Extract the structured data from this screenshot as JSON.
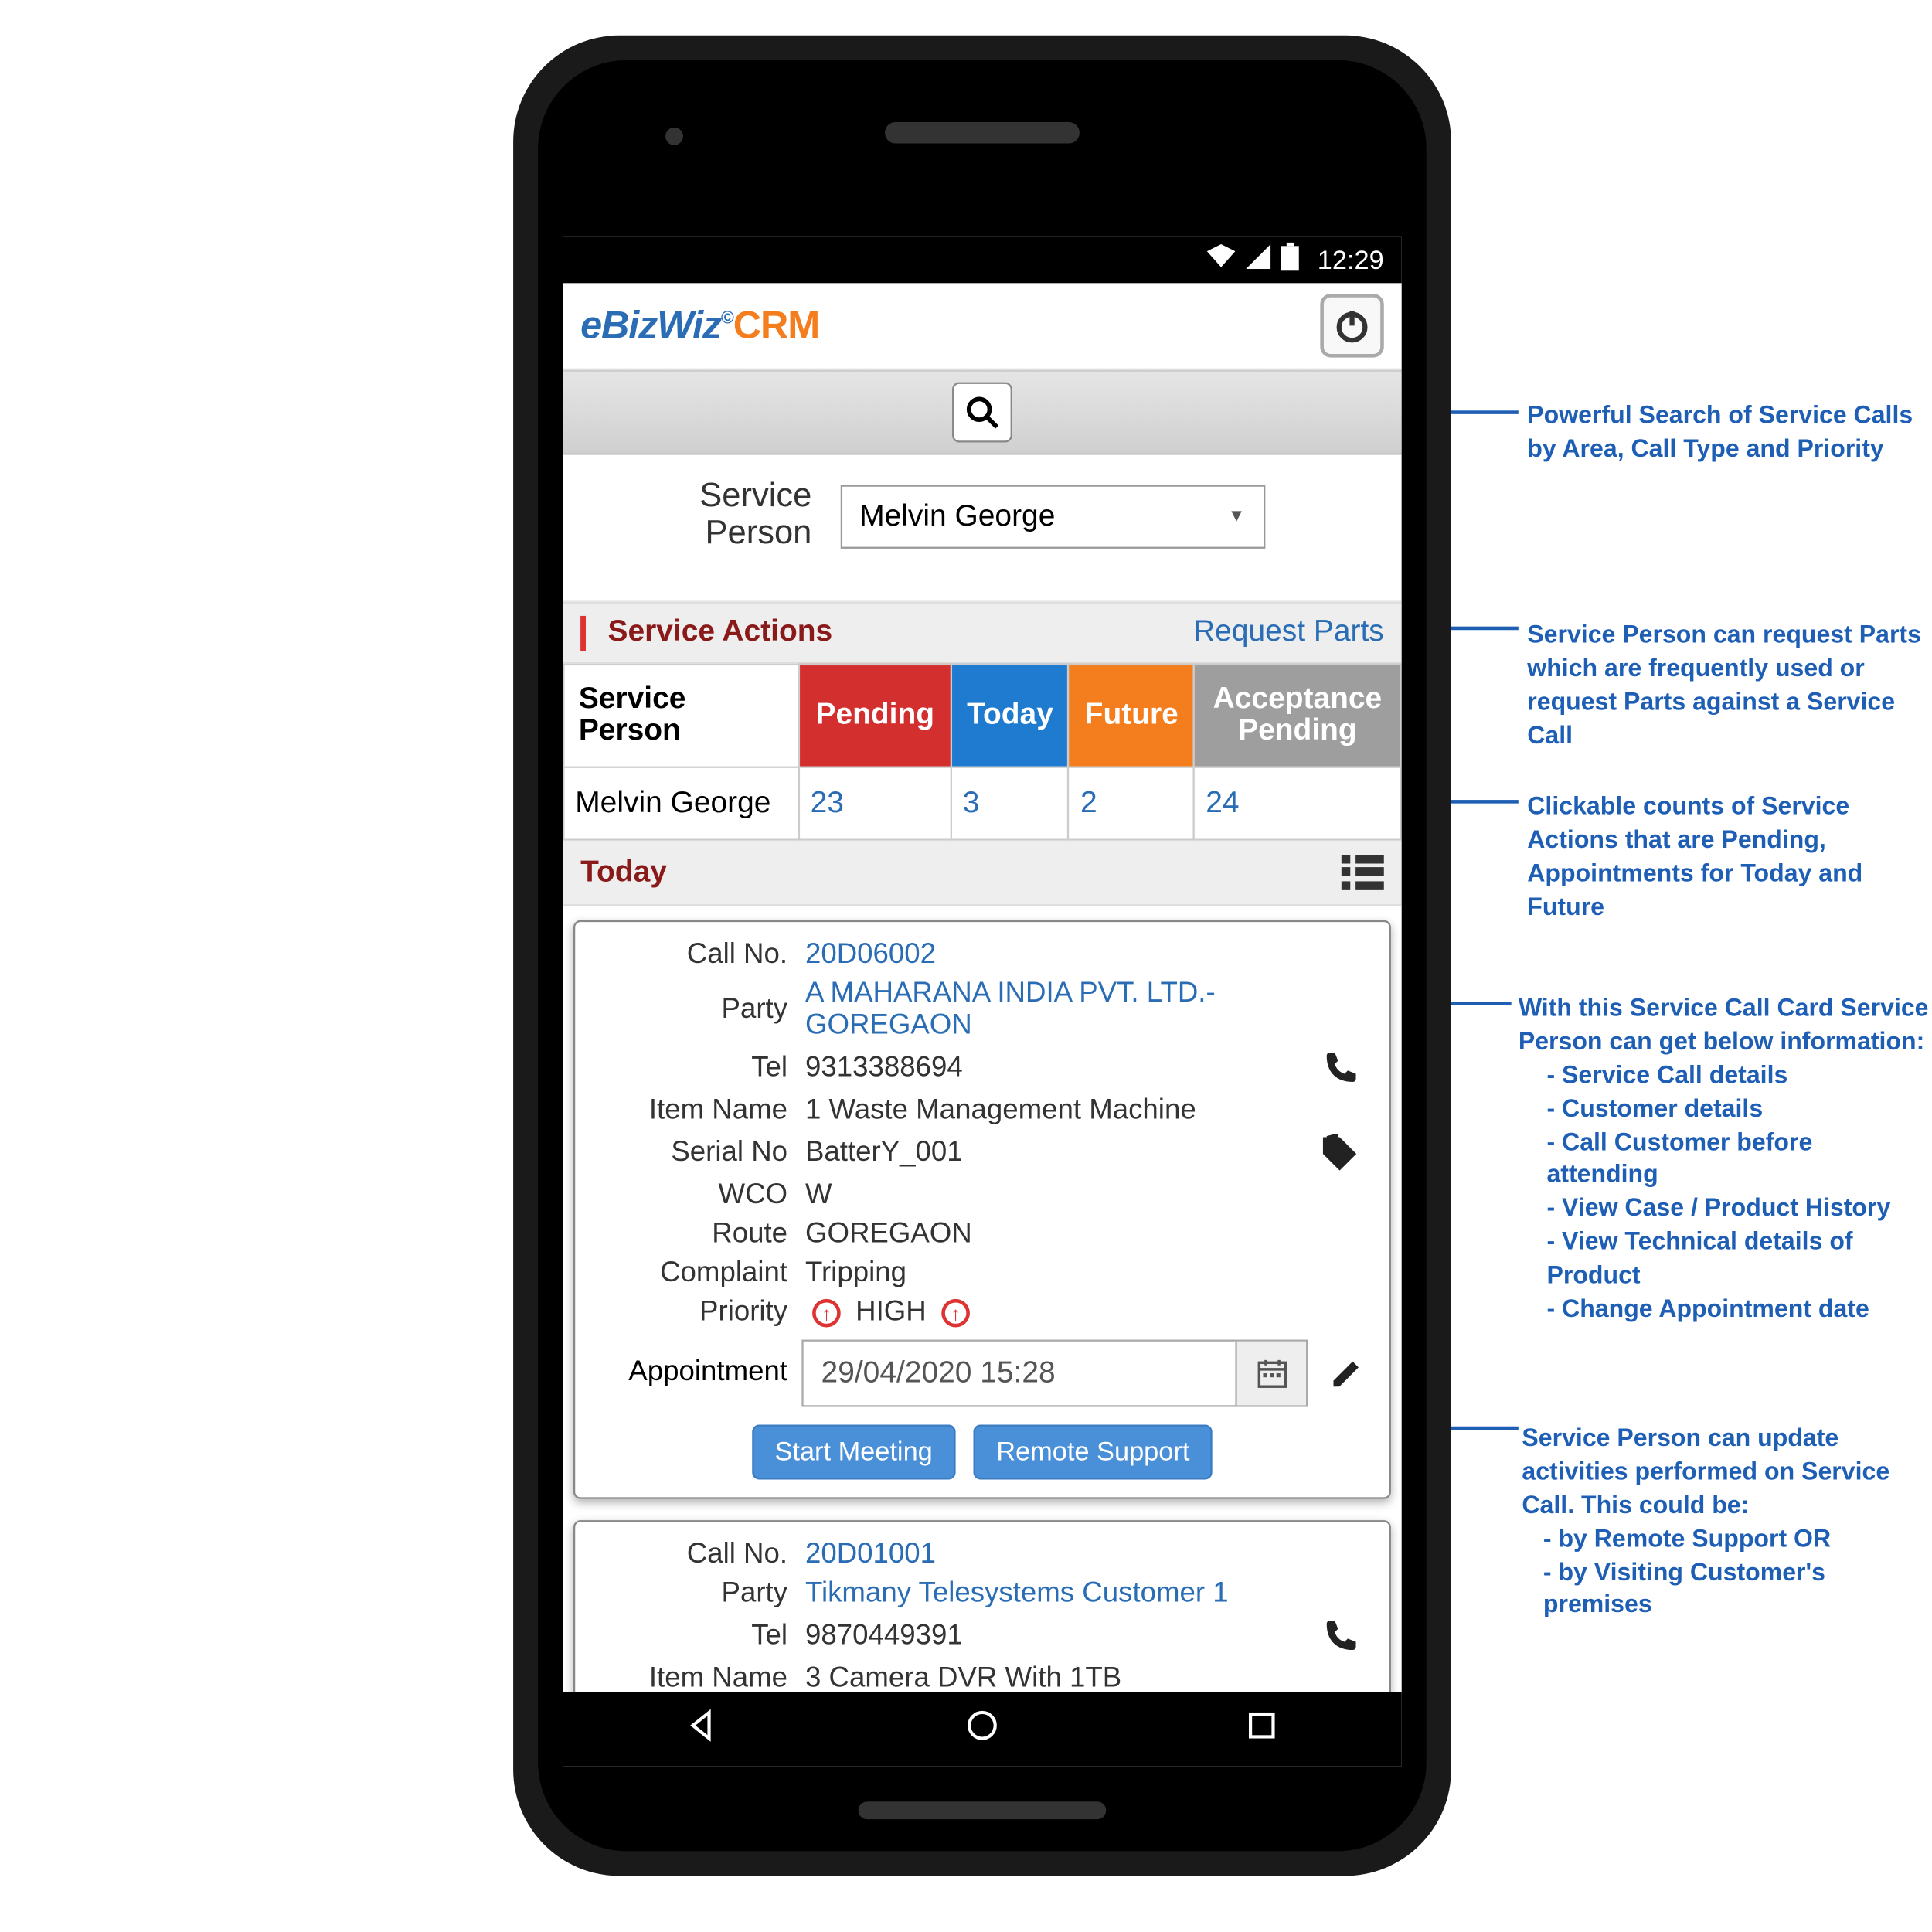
{
  "status_bar": {
    "time": "12:29"
  },
  "app": {
    "logo_parts": {
      "e": "e",
      "biz": "Biz",
      "wiz": "Wiz",
      "reg": "©",
      "crm": "CRM"
    }
  },
  "person": {
    "label": "Service\nPerson",
    "selected": "Melvin George"
  },
  "service_actions": {
    "title": "Service Actions",
    "request_parts": "Request Parts",
    "headers": {
      "sp": "Service\nPerson",
      "pending": "Pending",
      "today": "Today",
      "future": "Future",
      "accept": "Acceptance\nPending"
    },
    "row": {
      "name": "Melvin George",
      "pending": "23",
      "today": "3",
      "future": "2",
      "accept": "24"
    }
  },
  "today_section": {
    "title": "Today"
  },
  "card1": {
    "call_no_lbl": "Call No.",
    "call_no": "20D06002",
    "party_lbl": "Party",
    "party": "A MAHARANA INDIA PVT. LTD.-GOREGAON",
    "tel_lbl": "Tel",
    "tel": "9313388694",
    "item_lbl": "Item Name",
    "item": "1 Waste Management Machine",
    "serial_lbl": "Serial No",
    "serial": "BatterY_001",
    "wco_lbl": "WCO",
    "wco": "W",
    "route_lbl": "Route",
    "route": "GOREGAON",
    "complaint_lbl": "Complaint",
    "complaint": "Tripping",
    "priority_lbl": "Priority",
    "priority": "HIGH",
    "appt_lbl": "Appointment",
    "appt": "29/04/2020 15:28",
    "btn_start": "Start Meeting",
    "btn_remote": "Remote Support"
  },
  "card2": {
    "call_no_lbl": "Call No.",
    "call_no": "20D01001",
    "party_lbl": "Party",
    "party": "Tikmany Telesystems Customer 1",
    "tel_lbl": "Tel",
    "tel": "9870449391",
    "item_lbl": "Item Name",
    "item": "3 Camera DVR With 1TB"
  },
  "annotations": {
    "search": "Powerful Search of Service Calls by Area, Call Type and Priority",
    "request_parts": "Service Person can request Parts which are frequently used or request Parts against a Service Call",
    "counts": "Clickable counts of Service Actions that are Pending, Appointments for Today and Future",
    "card": "With this Service Call Card Service Person can get below information:",
    "card_items": [
      "- Service Call details",
      "- Customer details",
      "- Call Customer before attending",
      "- View Case / Product History",
      "- View Technical details of Product",
      "- Change Appointment date"
    ],
    "update": "Service Person can update activities performed on Service Call. This could be:",
    "update_items": [
      "- by Remote Support   OR",
      "- by Visiting Customer's premises"
    ]
  }
}
